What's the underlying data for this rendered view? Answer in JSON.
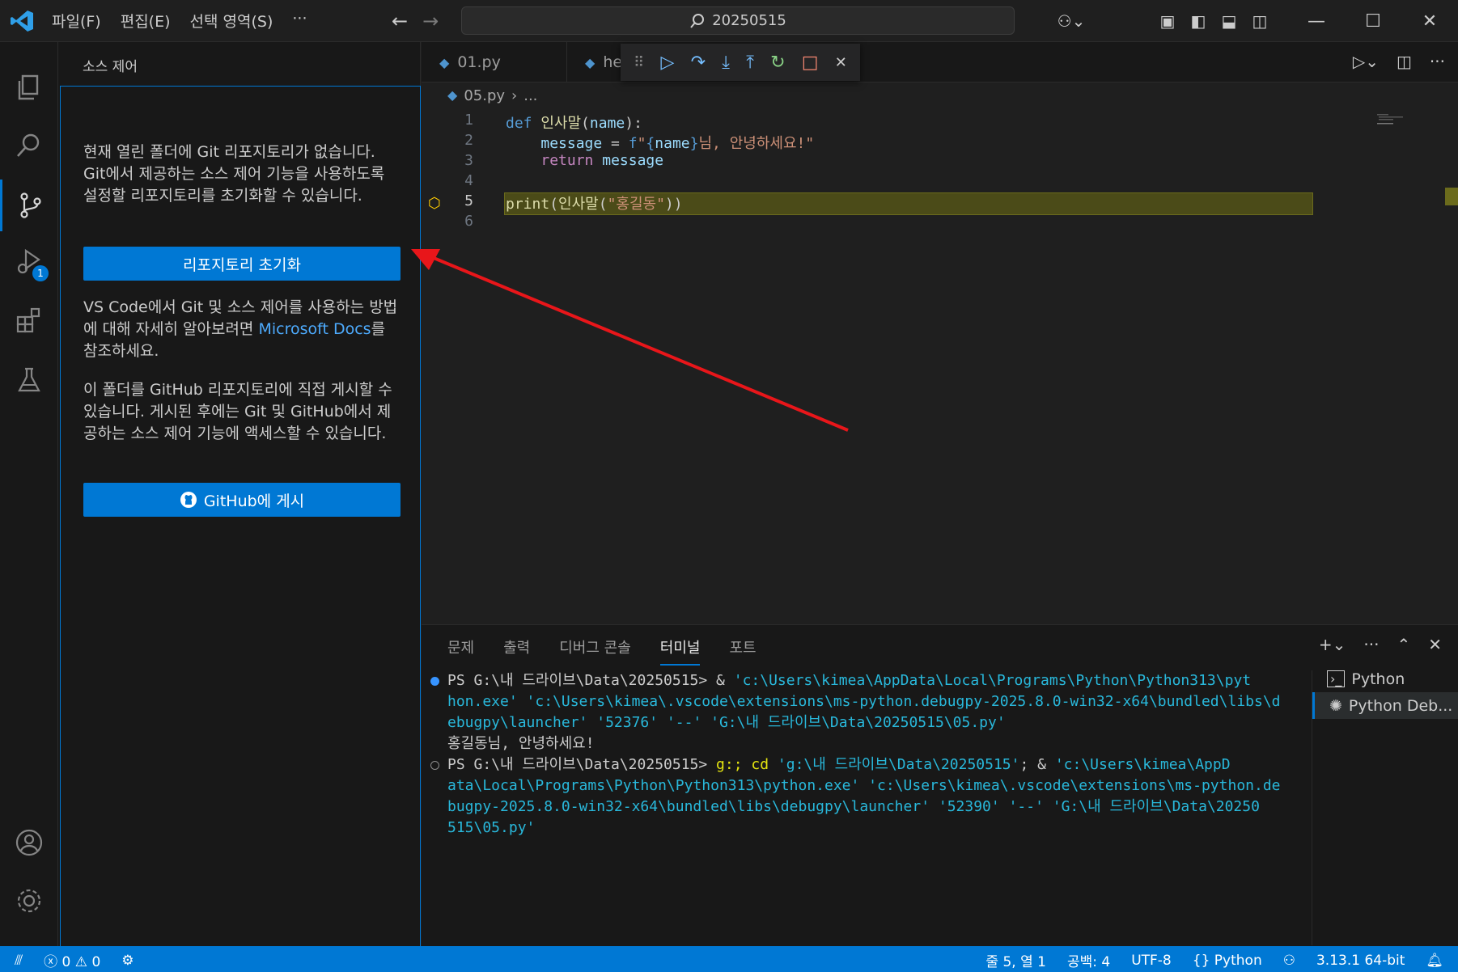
{
  "titlebar": {
    "menu": [
      "파일(F)",
      "편집(E)",
      "선택 영역(S)",
      "···"
    ],
    "search": "20250515",
    "colors": {
      "accent": "#0078d4"
    }
  },
  "sidebar": {
    "title": "소스 제어",
    "paragraph1": "현재 열린 폴더에 Git 리포지토리가 없습니다. Git에서 제공하는 소스 제어 기능을 사용하도록 설정할 리포지토리를 초기화할 수 있습니다.",
    "init_button": "리포지토리 초기화",
    "paragraph2_pre": "VS Code에서 Git 및 소스 제어를 사용하는 방법에 대해 자세히 알아보려면 ",
    "paragraph2_link": "Microsoft Docs",
    "paragraph2_post": "를 참조하세요.",
    "paragraph3": "이 폴더를 GitHub 리포지토리에 직접 게시할 수 있습니다. 게시된 후에는 Git 및 GitHub에서 제공하는 소스 제어 기능에 액세스할 수 있습니다.",
    "publish_button": "GitHub에 게시"
  },
  "activity": {
    "debug_badge": "1"
  },
  "editor": {
    "tabs": [
      {
        "label": "01.py"
      },
      {
        "label": "he"
      }
    ],
    "breadcrumb_file": "05.py",
    "breadcrumb_rest": "...",
    "lines": [
      "1",
      "2",
      "3",
      "4",
      "5",
      "6"
    ]
  },
  "panel": {
    "tabs": [
      "문제",
      "출력",
      "디버그 콘솔",
      "터미널",
      "포트"
    ],
    "active_tab": "터미널",
    "terminal": {
      "prompt": "PS G:\\내 드라이브\\Data\\20250515>",
      "cmd1_amp": " & ",
      "cmd1_l1": "'c:\\Users\\kimea\\AppData\\Local\\Programs\\Python\\Python313\\pyt",
      "cmd1_l2": "hon.exe' 'c:\\Users\\kimea\\.vscode\\extensions\\ms-python.debugpy-2025.8.0-win32-x64\\bundled\\libs\\d",
      "cmd1_l3": "ebugpy\\launcher' '52376' '--' 'G:\\내 드라이브\\Data\\20250515\\05.py'",
      "output": "홍길동님, 안녕하세요!",
      "cmd2_g": " g:; cd ",
      "cmd2_p1": "'g:\\내 드라이브\\Data\\20250515'",
      "cmd2_amp": "; & ",
      "cmd2_p2": "'c:\\Users\\kimea\\AppD",
      "cmd2_l2": "ata\\Local\\Programs\\Python\\Python313\\python.exe' 'c:\\Users\\kimea\\.vscode\\extensions\\ms-python.de",
      "cmd2_l3": "bugpy-2025.8.0-win32-x64\\bundled\\libs\\debugpy\\launcher' '52390' '--' 'G:\\내 드라이브\\Data\\20250",
      "cmd2_l4": "515\\05.py'"
    },
    "terminal_list": [
      "Python",
      "Python Deb..."
    ]
  },
  "statusbar": {
    "errors": "0",
    "warnings": "0",
    "position": "줄 5, 열 1",
    "spaces": "공백: 4",
    "encoding": "UTF-8",
    "language": "Python",
    "interpreter": "3.13.1 64-bit"
  }
}
